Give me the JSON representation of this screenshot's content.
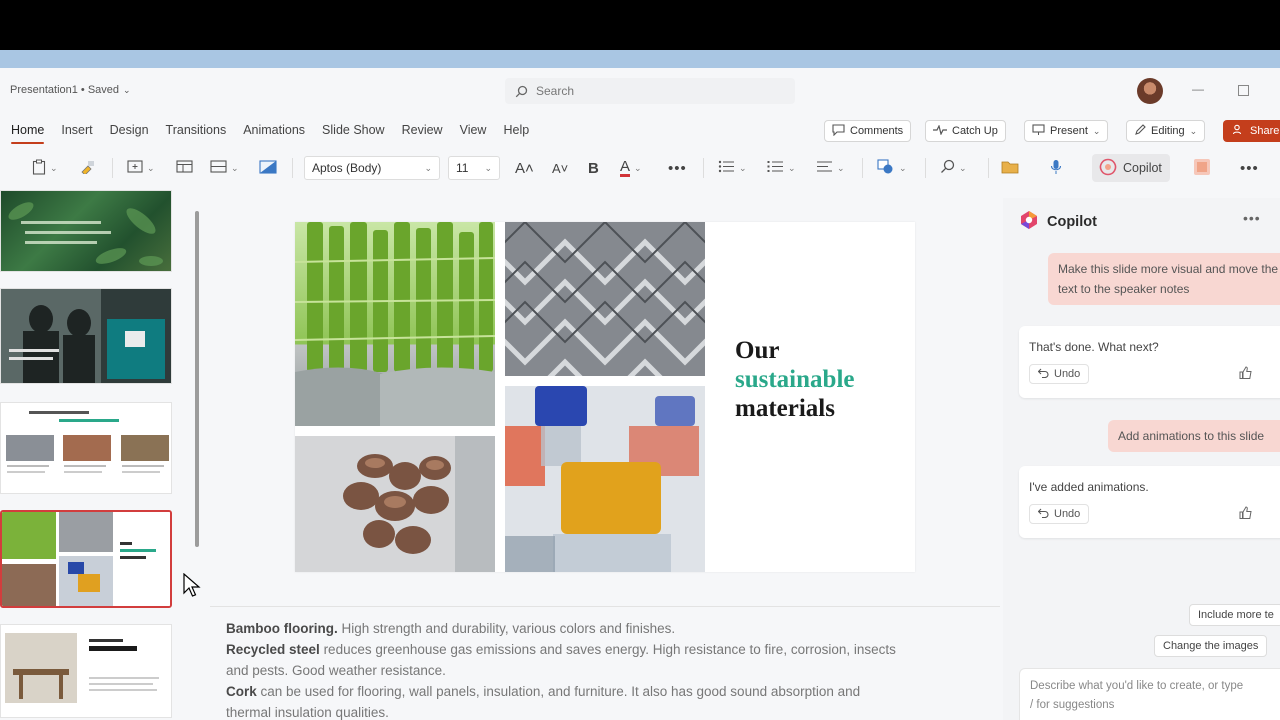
{
  "window": {
    "doc_title": "Presentation1 • Saved",
    "search_placeholder": "Search"
  },
  "ribbon": {
    "tabs": [
      "Home",
      "Insert",
      "Design",
      "Transitions",
      "Animations",
      "Slide Show",
      "Review",
      "View",
      "Help"
    ],
    "active_tab": "Home",
    "comments_label": "Comments",
    "catchup_label": "Catch Up",
    "present_label": "Present",
    "editing_label": "Editing",
    "share_label": "Share"
  },
  "toolbar": {
    "font_name": "Aptos (Body)",
    "font_size": "11",
    "copilot_label": "Copilot"
  },
  "slide": {
    "title_line1": "Our",
    "title_line2": "sustainable",
    "title_line3": "materials",
    "accent_color": "#2aa88a"
  },
  "notes": {
    "line1_bold": "Bamboo flooring.",
    "line1_text": " High strength and durability, various colors and finishes.",
    "line2_bold": "Recycled steel",
    "line2_text": " reduces greenhouse gas emissions and saves energy. High resistance to fire, corrosion, insects",
    "line3_text": "and pests. Good weather resistance.",
    "line4_bold": "Cork",
    "line4_text": " can be used for flooring, wall panels, insulation, and furniture. It also has good sound absorption and",
    "line5_text": "thermal insulation qualities."
  },
  "copilot": {
    "title": "Copilot",
    "user_msg_1": "Make this slide more visual and move the text to the speaker notes",
    "reply_1": "That's done. What next?",
    "user_msg_2": "Add animations to this slide",
    "reply_2": "I've added animations.",
    "undo_label": "Undo",
    "suggestion_1": "Include more te",
    "suggestion_2": "Change the images",
    "prompt_placeholder_1": "Describe what you'd like to create, or type",
    "prompt_placeholder_2": "/ for suggestions"
  },
  "colors": {
    "brand_red": "#c43e1c",
    "user_bubble": "#f8d7d2"
  }
}
